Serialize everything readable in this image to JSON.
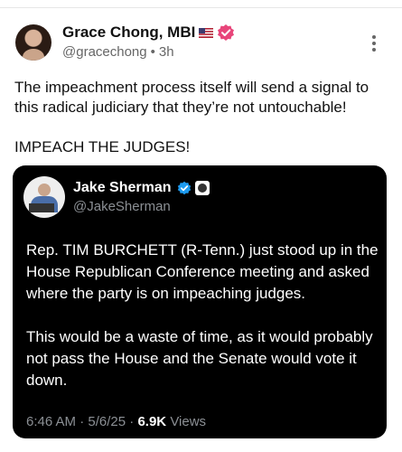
{
  "author": {
    "name": "Grace Chong, MBI",
    "handle": "@gracechong",
    "time": "3h",
    "separator": "•"
  },
  "icons": {
    "flag": "us-flag-icon",
    "verified": "verified-badge-icon",
    "more": "more-vertical-icon"
  },
  "post": {
    "paragraph1": "The impeachment process itself will send a signal to this radical judiciary that they’re not untouchable!",
    "paragraph2": "IMPEACH THE JUDGES!"
  },
  "quote": {
    "name": "Jake Sherman",
    "handle": "@JakeSherman",
    "paragraph1": "Rep. TIM BURCHETT (R-Tenn.) just stood up in the House Republican Conference meeting and asked where the party is on impeaching judges.",
    "paragraph2": "This would be a waste of time, as it would probably not pass the House and the Senate would vote it down.",
    "time": "6:46 AM",
    "date": "5/6/25",
    "dot": "·",
    "views_count": "6.9K",
    "views_label": "Views"
  },
  "colors": {
    "verified_pink": "#e8457a",
    "verified_blue": "#1d9bf0",
    "quote_bg": "#000000"
  }
}
